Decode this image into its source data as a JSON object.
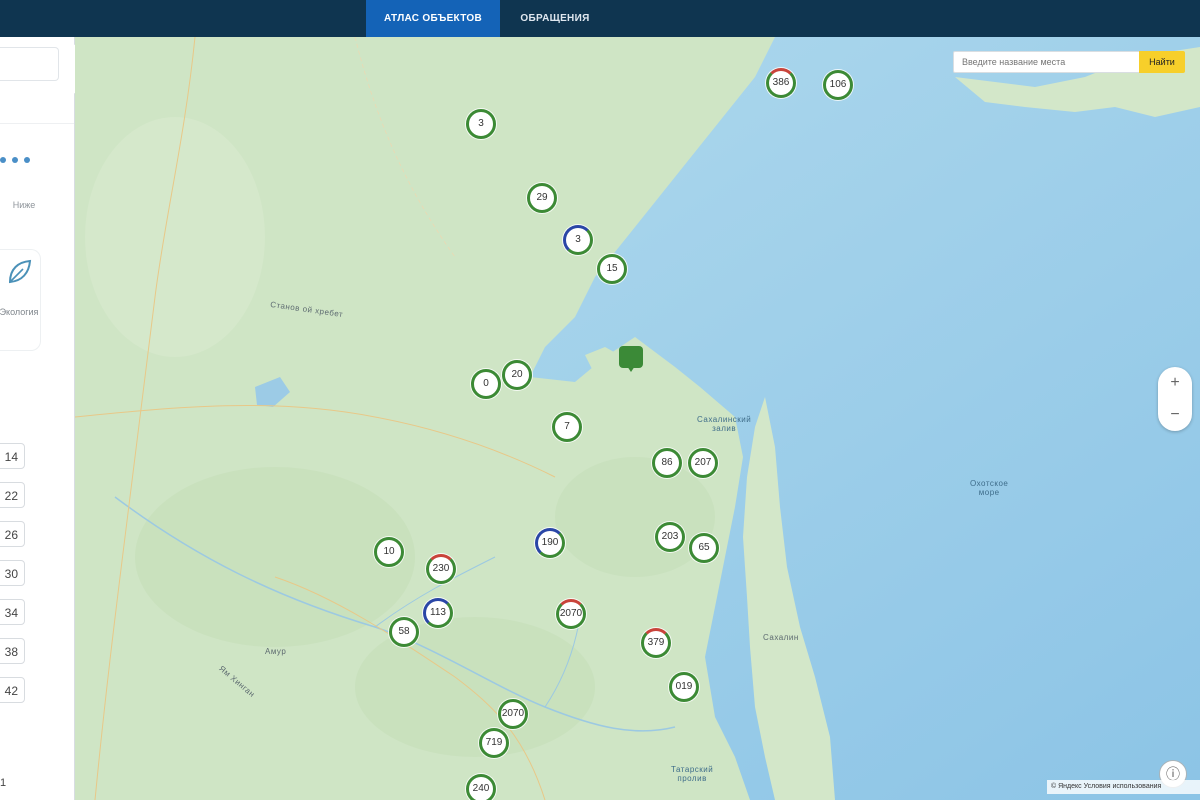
{
  "nav": {
    "tabs": [
      {
        "label": "АТЛАС ОБЪЕКТОВ",
        "active": true
      },
      {
        "label": "ОБРАЩЕНИЯ",
        "active": false
      }
    ]
  },
  "sidebar": {
    "label_top": "Ниже",
    "label_card": "Экология",
    "numbers": [
      "14",
      "22",
      "26",
      "30",
      "34",
      "38",
      "42"
    ],
    "bottom": "1"
  },
  "search": {
    "placeholder": "Введите название места",
    "button": "Найти"
  },
  "zoom": {
    "in": "+",
    "out": "−"
  },
  "map_labels": [
    {
      "text": "Станов ой  хребет"
    },
    {
      "text": "Охотское\nморе"
    },
    {
      "text": "Сахалинский\nзалив"
    },
    {
      "text": "Татарский\nпролив"
    },
    {
      "text": "Сахалин"
    },
    {
      "text": "Амур"
    },
    {
      "text": "Ям Хинган"
    }
  ],
  "clusters": [
    {
      "label": "386",
      "ring": "red"
    },
    {
      "label": "106",
      "ring": "green"
    },
    {
      "label": "3",
      "ring": "green"
    },
    {
      "label": "29",
      "ring": "green"
    },
    {
      "label": "3",
      "ring": "blue"
    },
    {
      "label": "15",
      "ring": "green"
    },
    {
      "label": "20",
      "ring": "green"
    },
    {
      "label": "0",
      "ring": "green"
    },
    {
      "label": "7",
      "ring": "green"
    },
    {
      "label": "86",
      "ring": "green"
    },
    {
      "label": "207",
      "ring": "green"
    },
    {
      "label": "190",
      "ring": "blue"
    },
    {
      "label": "203",
      "ring": "green"
    },
    {
      "label": "65",
      "ring": "green"
    },
    {
      "label": "10",
      "ring": "green"
    },
    {
      "label": "230",
      "ring": "red"
    },
    {
      "label": "113",
      "ring": "blue"
    },
    {
      "label": "58",
      "ring": "green"
    },
    {
      "label": "2070",
      "ring": "red"
    },
    {
      "label": "379",
      "ring": "red"
    },
    {
      "label": "019",
      "ring": "green"
    },
    {
      "label": "2070",
      "ring": "green"
    },
    {
      "label": "719",
      "ring": "green"
    },
    {
      "label": "240",
      "ring": "green"
    }
  ],
  "attribution": "© Яндекс Условия использования",
  "colors": {
    "topbar": "#0f3550",
    "active_tab": "#1463b7",
    "cluster_ring": "#3c8a35",
    "search_button": "#f7cf2a",
    "sea": "#a3d2ea",
    "land": "#cfe5c5"
  }
}
